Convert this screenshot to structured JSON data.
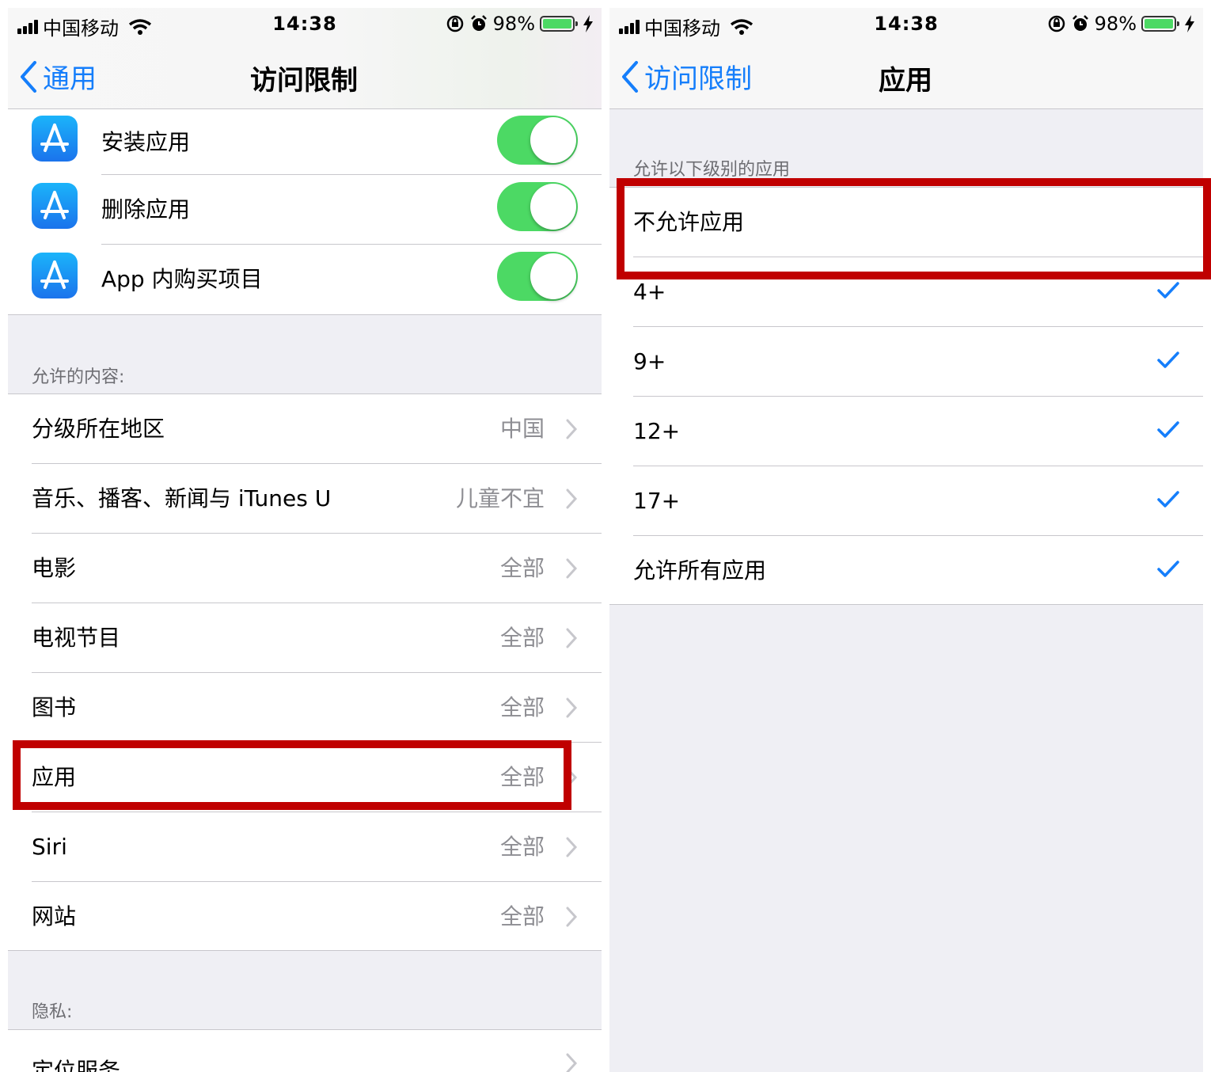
{
  "status_bar": {
    "carrier": "中国移动",
    "time": "14:38",
    "battery": "98%",
    "battery_level": 0.98
  },
  "left_screen": {
    "nav": {
      "back_label": "通用",
      "title": "访问限制"
    },
    "app_toggles": [
      {
        "label": "安装应用",
        "on": true
      },
      {
        "label": "删除应用",
        "on": true
      },
      {
        "label": "App 内购买项目",
        "on": true
      }
    ],
    "allowed_content_header": "允许的内容:",
    "allowed_content": [
      {
        "label": "分级所在地区",
        "value": "中国"
      },
      {
        "label": "音乐、播客、新闻与 iTunes U",
        "value": "儿童不宜"
      },
      {
        "label": "电影",
        "value": "全部"
      },
      {
        "label": "电视节目",
        "value": "全部"
      },
      {
        "label": "图书",
        "value": "全部"
      },
      {
        "label": "应用",
        "value": "全部"
      },
      {
        "label": "Siri",
        "value": "全部"
      },
      {
        "label": "网站",
        "value": "全部"
      }
    ],
    "privacy_header": "隐私:",
    "privacy_items": [
      {
        "label": "定位服务"
      }
    ]
  },
  "right_screen": {
    "nav": {
      "back_label": "访问限制",
      "title": "应用"
    },
    "section_header": "允许以下级别的应用",
    "options": [
      {
        "label": "不允许应用",
        "checked": false
      },
      {
        "label": "4+",
        "checked": true
      },
      {
        "label": "9+",
        "checked": true
      },
      {
        "label": "12+",
        "checked": true
      },
      {
        "label": "17+",
        "checked": true
      },
      {
        "label": "允许所有应用",
        "checked": true
      }
    ]
  },
  "colors": {
    "accent": "#157efb",
    "toggle_on": "#4cd964",
    "highlight": "#c00000",
    "app_store_icon": "#1b8cf5"
  },
  "icons": [
    "app-store-icon",
    "chevron-right-icon",
    "checkmark-icon",
    "chevron-left-icon",
    "wifi-icon",
    "alarm-icon",
    "rotation-lock-icon",
    "charging-bolt-icon"
  ]
}
